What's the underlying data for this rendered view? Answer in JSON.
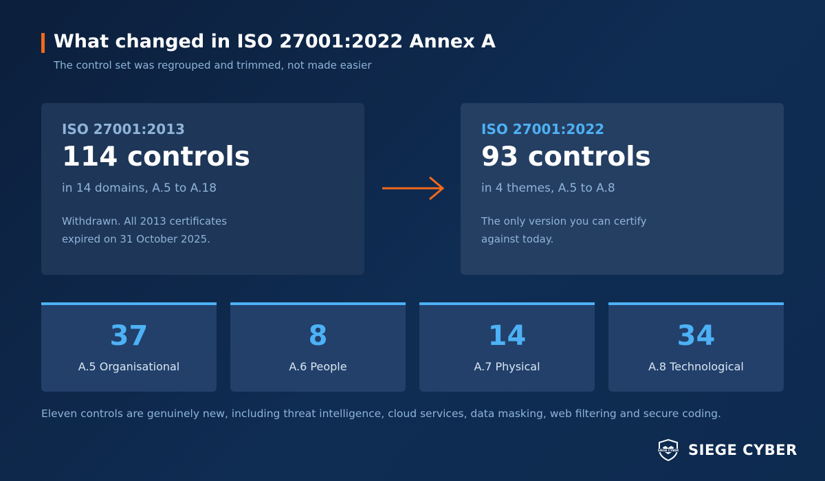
{
  "header": {
    "title": "What changed in ISO 27001:2022 Annex A",
    "subtitle": "The control set was regrouped and trimmed, not made easier"
  },
  "comparison": {
    "old": {
      "label": "ISO 27001:2013",
      "count": "114 controls",
      "scope": "in 14 domains, A.5 to A.18",
      "note_line1": "Withdrawn. All 2013 certificates",
      "note_line2": "expired on 31 October 2025."
    },
    "new": {
      "label": "ISO 27001:2022",
      "count": "93 controls",
      "scope": "in 4 themes, A.5 to A.8",
      "note_line1": "The only version you can certify",
      "note_line2": "against today."
    }
  },
  "themes": [
    {
      "count": "37",
      "name": "A.5 Organisational"
    },
    {
      "count": "8",
      "name": "A.6 People"
    },
    {
      "count": "14",
      "name": "A.7 Physical"
    },
    {
      "count": "34",
      "name": "A.8 Technological"
    }
  ],
  "footnote": "Eleven controls are genuinely new, including threat intelligence, cloud services, data masking, web filtering and secure coding.",
  "brand": {
    "name": "SIEGE CYBER",
    "logo_text": "SIEGE CYBER"
  },
  "colors": {
    "accent_orange": "#f26a1b",
    "accent_blue": "#4db1f5",
    "background": "#0f2c52"
  },
  "icons": {
    "arrow": "right-arrow-icon",
    "logo": "shield-logo-icon"
  }
}
